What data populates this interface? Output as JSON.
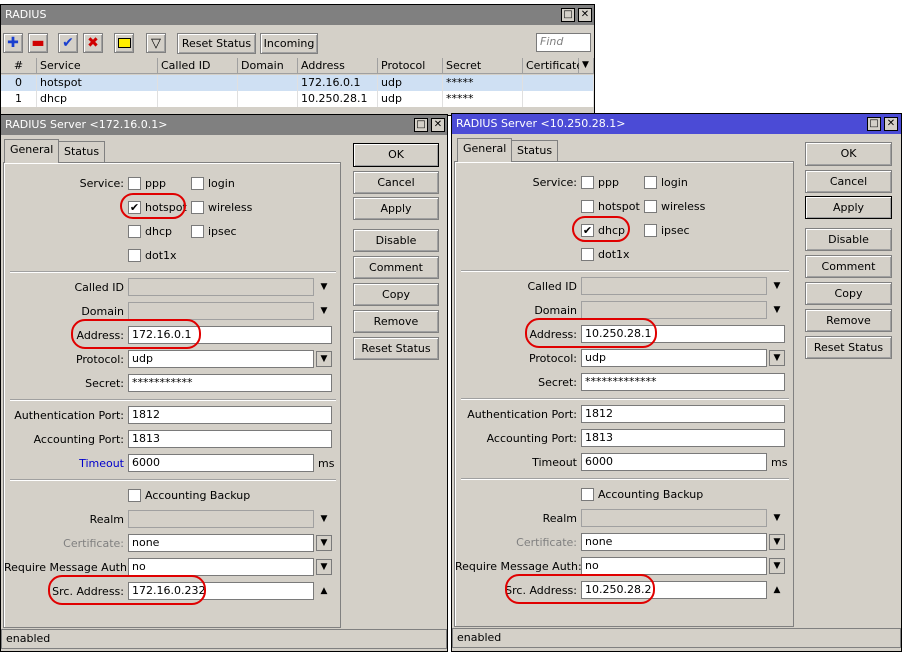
{
  "list_window": {
    "title": "RADIUS",
    "toolbar": {
      "reset_status": "Reset Status",
      "incoming": "Incoming",
      "find_placeholder": "Find"
    },
    "columns": [
      "#",
      "Service",
      "Called ID",
      "Domain",
      "Address",
      "Protocol",
      "Secret",
      "Certificate"
    ],
    "rows": [
      {
        "num": "0",
        "service": "hotspot",
        "called_id": "",
        "domain": "",
        "address": "172.16.0.1",
        "protocol": "udp",
        "secret": "*****",
        "certificate": ""
      },
      {
        "num": "1",
        "service": "dhcp",
        "called_id": "",
        "domain": "",
        "address": "10.250.28.1",
        "protocol": "udp",
        "secret": "*****",
        "certificate": ""
      }
    ]
  },
  "server1": {
    "title": "RADIUS Server <172.16.0.1>",
    "tabs": [
      "General",
      "Status"
    ],
    "labels": {
      "service": "Service:",
      "called_id": "Called ID",
      "domain": "Domain",
      "address": "Address:",
      "protocol": "Protocol:",
      "secret": "Secret:",
      "auth_port": "Authentication Port:",
      "acct_port": "Accounting Port:",
      "timeout": "Timeout",
      "ms": "ms",
      "acct_backup": "Accounting Backup",
      "realm": "Realm",
      "certificate": "Certificate:",
      "req_msg_auth": "Require Message Auth:",
      "src_address": "Src. Address:"
    },
    "services": {
      "ppp": "ppp",
      "login": "login",
      "hotspot": "hotspot",
      "wireless": "wireless",
      "dhcp": "dhcp",
      "ipsec": "ipsec",
      "dot1x": "dot1x"
    },
    "values": {
      "address": "172.16.0.1",
      "protocol": "udp",
      "secret": "***********",
      "auth_port": "1812",
      "acct_port": "1813",
      "timeout": "6000",
      "certificate": "none",
      "req_msg_auth": "no",
      "src_address": "172.16.0.232"
    },
    "buttons": [
      "OK",
      "Cancel",
      "Apply",
      "Disable",
      "Comment",
      "Copy",
      "Remove",
      "Reset Status"
    ],
    "status": "enabled"
  },
  "server2": {
    "title": "RADIUS Server <10.250.28.1>",
    "tabs": [
      "General",
      "Status"
    ],
    "labels": {
      "service": "Service:",
      "called_id": "Called ID",
      "domain": "Domain",
      "address": "Address:",
      "protocol": "Protocol:",
      "secret": "Secret:",
      "auth_port": "Authentication Port:",
      "acct_port": "Accounting Port:",
      "timeout": "Timeout",
      "ms": "ms",
      "acct_backup": "Accounting Backup",
      "realm": "Realm",
      "certificate": "Certificate:",
      "req_msg_auth": "Require Message Auth:",
      "src_address": "Src. Address:"
    },
    "services": {
      "ppp": "ppp",
      "login": "login",
      "hotspot": "hotspot",
      "wireless": "wireless",
      "dhcp": "dhcp",
      "ipsec": "ipsec",
      "dot1x": "dot1x"
    },
    "values": {
      "address": "10.250.28.1",
      "protocol": "udp",
      "secret": "*************",
      "auth_port": "1812",
      "acct_port": "1813",
      "timeout": "6000",
      "certificate": "none",
      "req_msg_auth": "no",
      "src_address": "10.250.28.2"
    },
    "buttons": [
      "OK",
      "Cancel",
      "Apply",
      "Disable",
      "Comment",
      "Copy",
      "Remove",
      "Reset Status"
    ],
    "status": "enabled"
  },
  "icons": {
    "add": "plus-icon",
    "remove": "minus-icon",
    "enable": "check-icon",
    "disable": "x-icon",
    "comment": "note-icon",
    "filter": "filter-icon"
  }
}
